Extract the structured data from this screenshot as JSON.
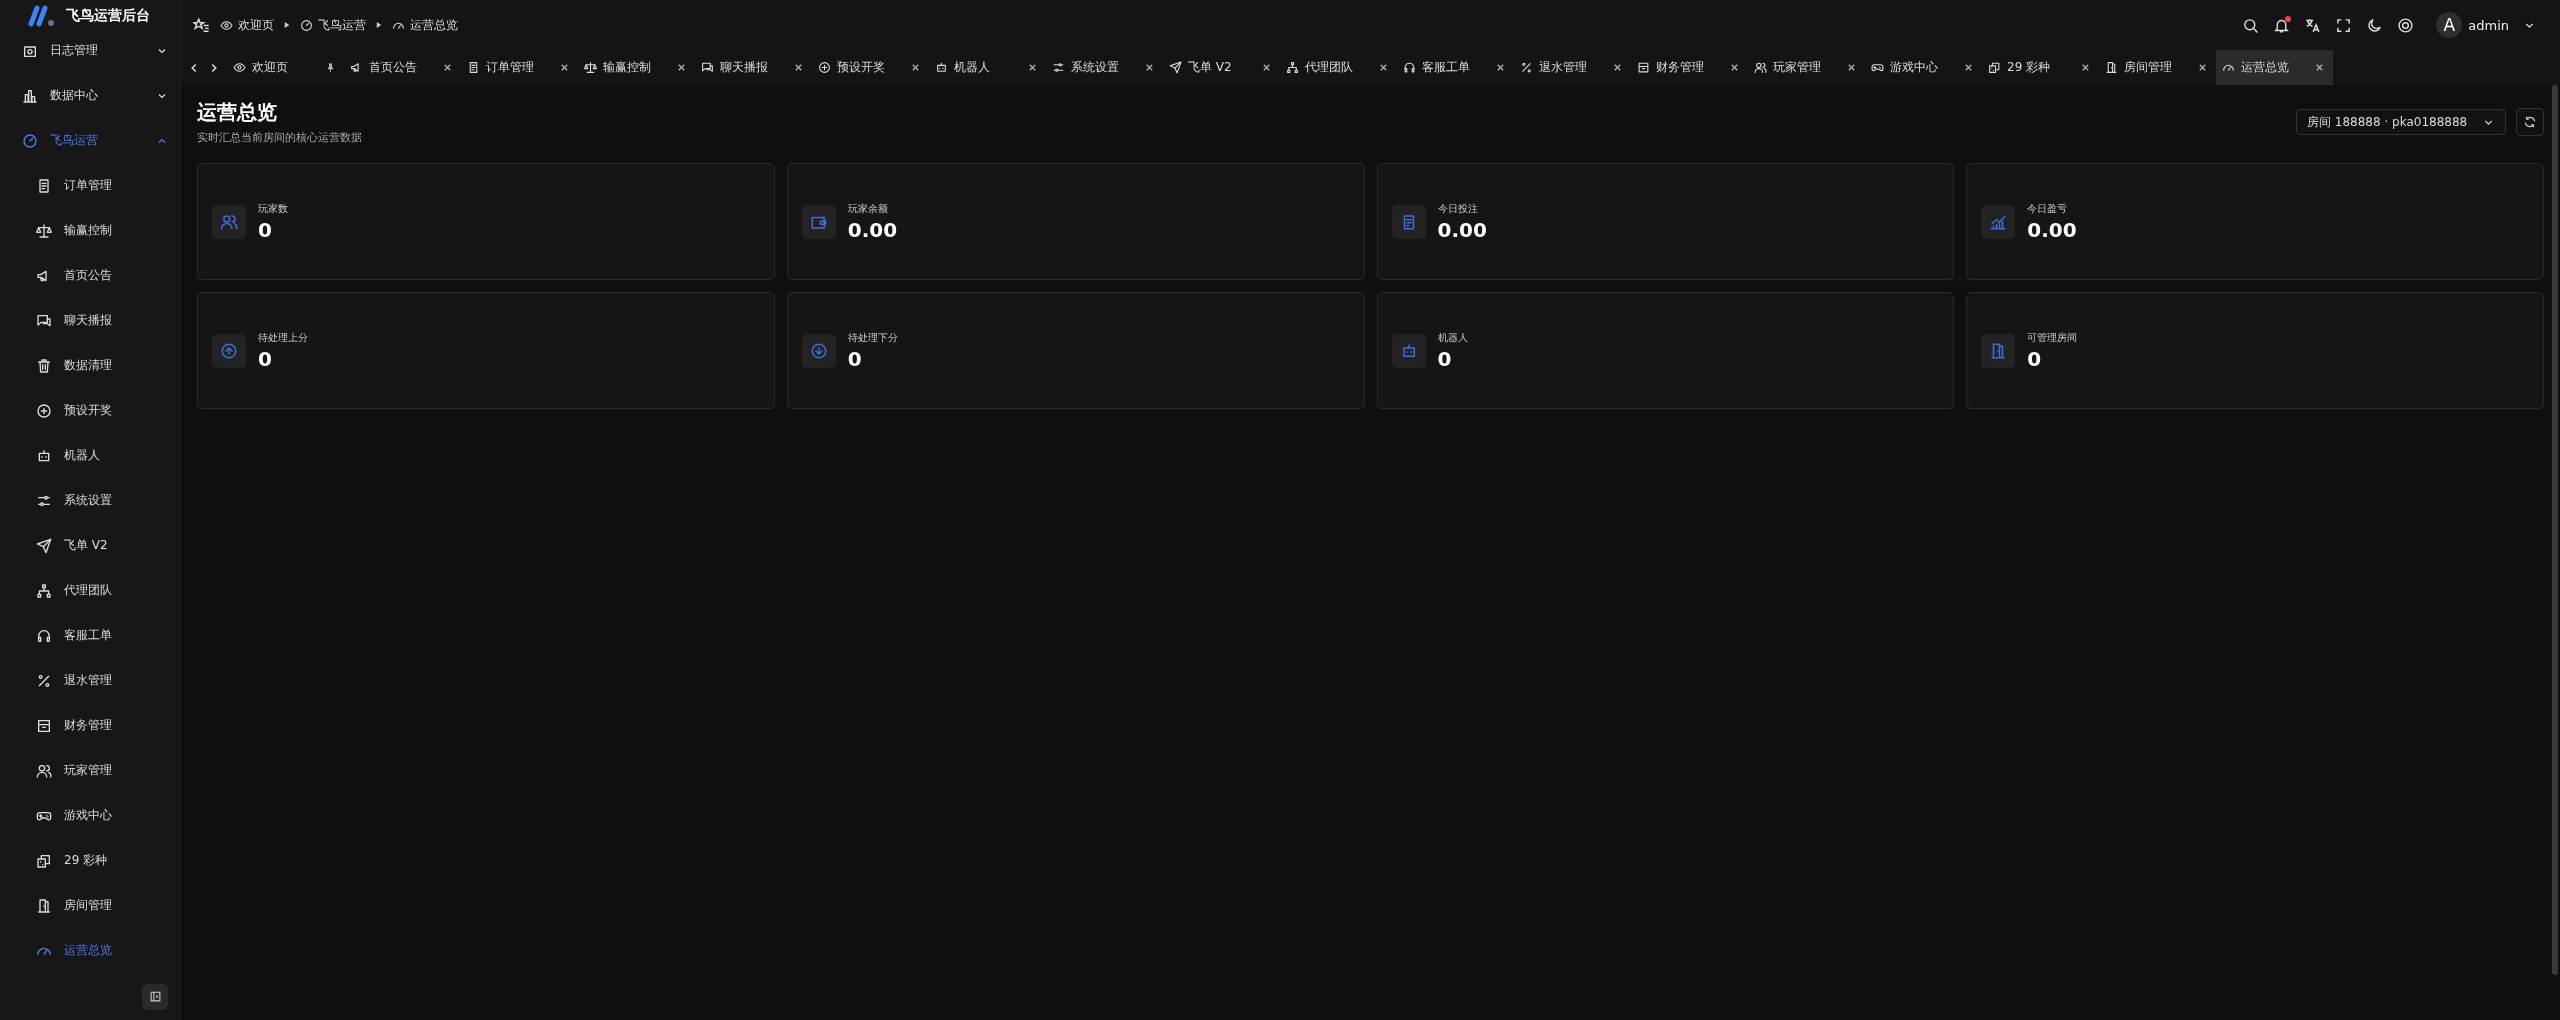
{
  "app": {
    "title": "飞鸟运营后台"
  },
  "sidebar": {
    "items": [
      {
        "label": "日志管理",
        "expanded": false,
        "selected": false
      },
      {
        "label": "数据中心",
        "expanded": false,
        "selected": false
      },
      {
        "label": "飞鸟运营",
        "expanded": true,
        "selected": true,
        "children": [
          {
            "label": "订单管理",
            "selected": false
          },
          {
            "label": "输赢控制",
            "selected": false
          },
          {
            "label": "首页公告",
            "selected": false
          },
          {
            "label": "聊天播报",
            "selected": false
          },
          {
            "label": "数据清理",
            "selected": false
          },
          {
            "label": "预设开奖",
            "selected": false
          },
          {
            "label": "机器人",
            "selected": false
          },
          {
            "label": "系统设置",
            "selected": false
          },
          {
            "label": "飞单 V2",
            "selected": false
          },
          {
            "label": "代理团队",
            "selected": false
          },
          {
            "label": "客服工单",
            "selected": false
          },
          {
            "label": "退水管理",
            "selected": false
          },
          {
            "label": "财务管理",
            "selected": false
          },
          {
            "label": "玩家管理",
            "selected": false
          },
          {
            "label": "游戏中心",
            "selected": false
          },
          {
            "label": "29 彩种",
            "selected": false
          },
          {
            "label": "房间管理",
            "selected": false
          },
          {
            "label": "运营总览",
            "selected": true
          }
        ]
      }
    ]
  },
  "breadcrumb": [
    "欢迎页",
    "飞鸟运营",
    "运营总览"
  ],
  "header": {
    "notification_dot": true,
    "avatar": "A",
    "user": "admin"
  },
  "tabs": [
    {
      "label": "欢迎页",
      "pinned": true,
      "selected": false
    },
    {
      "label": "首页公告",
      "pinned": false,
      "selected": false
    },
    {
      "label": "订单管理",
      "pinned": false,
      "selected": false
    },
    {
      "label": "输赢控制",
      "pinned": false,
      "selected": false
    },
    {
      "label": "聊天播报",
      "pinned": false,
      "selected": false
    },
    {
      "label": "预设开奖",
      "pinned": false,
      "selected": false
    },
    {
      "label": "机器人",
      "pinned": false,
      "selected": false
    },
    {
      "label": "系统设置",
      "pinned": false,
      "selected": false
    },
    {
      "label": "飞单 V2",
      "pinned": false,
      "selected": false
    },
    {
      "label": "代理团队",
      "pinned": false,
      "selected": false
    },
    {
      "label": "客服工单",
      "pinned": false,
      "selected": false
    },
    {
      "label": "退水管理",
      "pinned": false,
      "selected": false
    },
    {
      "label": "财务管理",
      "pinned": false,
      "selected": false
    },
    {
      "label": "玩家管理",
      "pinned": false,
      "selected": false
    },
    {
      "label": "游戏中心",
      "pinned": false,
      "selected": false
    },
    {
      "label": "29 彩种",
      "pinned": false,
      "selected": false
    },
    {
      "label": "房间管理",
      "pinned": false,
      "selected": false
    },
    {
      "label": "运营总览",
      "pinned": false,
      "selected": true
    }
  ],
  "page": {
    "title": "运营总览",
    "subtitle": "实时汇总当前房间的核心运营数据",
    "room_select": "房间 188888 · pka0188888",
    "stats": [
      {
        "label": "玩家数",
        "value": "0"
      },
      {
        "label": "玩家余额",
        "value": "0.00"
      },
      {
        "label": "今日投注",
        "value": "0.00"
      },
      {
        "label": "今日盈亏",
        "value": "0.00"
      },
      {
        "label": "待处理上分",
        "value": "0"
      },
      {
        "label": "待处理下分",
        "value": "0"
      },
      {
        "label": "机器人",
        "value": "0"
      },
      {
        "label": "可管理房间",
        "value": "0"
      }
    ]
  }
}
